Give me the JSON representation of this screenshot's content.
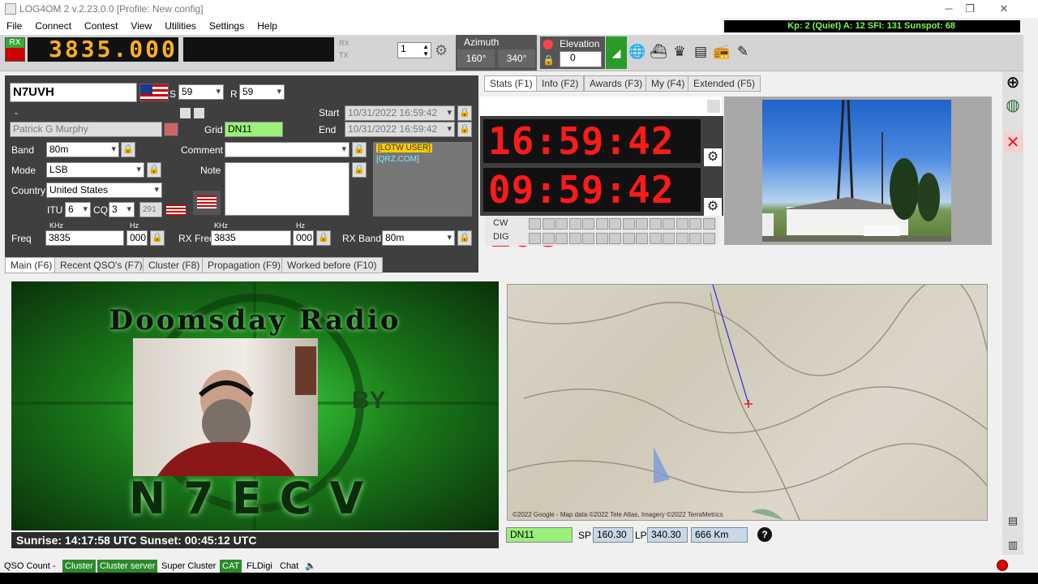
{
  "window": {
    "title": "LOG4OM 2 v.2.23.0.0 [Profile: New config]",
    "minimize": "─",
    "maximize": "❐",
    "close": "✕"
  },
  "menu": [
    "File",
    "Connect",
    "Contest",
    "View",
    "Utilities",
    "Settings",
    "Help"
  ],
  "solar": "Kp: 2 (Quiet)  A: 12  SFI: 131 Sunspot: 68",
  "toolbar": {
    "rx_label": "RX",
    "frequency": "3835.000",
    "rx": "RX",
    "tx": "TX",
    "spin_value": "1",
    "azimuth_label": "Azimuth",
    "az_sp": "160°",
    "az_lp": "340°",
    "elevation_label": "Elevation",
    "elevation_value": "0"
  },
  "qso": {
    "callsign": "N7UVH",
    "s_label": "S",
    "s_value": "59",
    "r_label": "R",
    "r_value": "59",
    "dash": "-",
    "name": "Patrick G Murphy",
    "grid_label": "Grid",
    "grid": "DN11",
    "start_label": "Start",
    "start": "10/31/2022 16:59:42",
    "end_label": "End",
    "end": "10/31/2022 16:59:42",
    "band_label": "Band",
    "band": "80m",
    "comment_label": "Comment",
    "mode_label": "Mode",
    "mode": "LSB",
    "note_label": "Note",
    "country_label": "Country",
    "country": "United States",
    "itu_label": "ITU",
    "itu": "6",
    "cq_label": "CQ",
    "cq": "3",
    "dxcc": "291",
    "lotw": "[LOTW USER]",
    "qrz": "[QRZ.COM]",
    "khz1": "KHz",
    "hz1": "Hz",
    "khz2": "KHz",
    "hz2": "Hz",
    "freq_label": "Freq",
    "freq_khz": "3835",
    "freq_hz": "000",
    "rxfreq_label": "RX Freq",
    "rxfreq_khz": "3835",
    "rxfreq_hz": "000",
    "rxband_label": "RX Band",
    "rxband": "80m"
  },
  "info_tabs": [
    "Stats (F1)",
    "Info (F2)",
    "Awards (F3)",
    "My (F4)",
    "Extended (F5)"
  ],
  "clocks": {
    "utc": "16:59:42 utc",
    "loc": "09:59:42 Loc",
    "cw_label": "CW",
    "dig_label": "DIG"
  },
  "main_tabs": [
    "Main (F6)",
    "Recent QSO's (F7)",
    "Cluster (F8)",
    "Propagation (F9)",
    "Worked before (F10)"
  ],
  "video": {
    "title": "Doomsday Radio",
    "by": "BY",
    "callsign": "N7ECV"
  },
  "sun": "Sunrise: 14:17:58 UTC  Sunset: 00:45:12 UTC",
  "map": {
    "credit": "©2022 Google - Map data ©2022 Tele Atlas, Imagery ©2022 TerraMetrics"
  },
  "bearing": {
    "grid": "DN11",
    "sp_label": "SP",
    "sp": "160.30",
    "lp_label": "LP",
    "lp": "340.30",
    "distance": "666 Km",
    "help": "?"
  },
  "status": {
    "qso_count": "QSO Count",
    "qso_dash": "-",
    "cluster": "Cluster",
    "cluster_server": "Cluster server",
    "super_cluster": "Super Cluster",
    "cat": "CAT",
    "fldigi": "FLDigi",
    "chat": "Chat"
  },
  "colors": {
    "accent_green": "#2a8a2a",
    "clock_red": "#ff1a1a",
    "freq_amber": "#ffb020",
    "solar_green": "#7cff4a"
  }
}
